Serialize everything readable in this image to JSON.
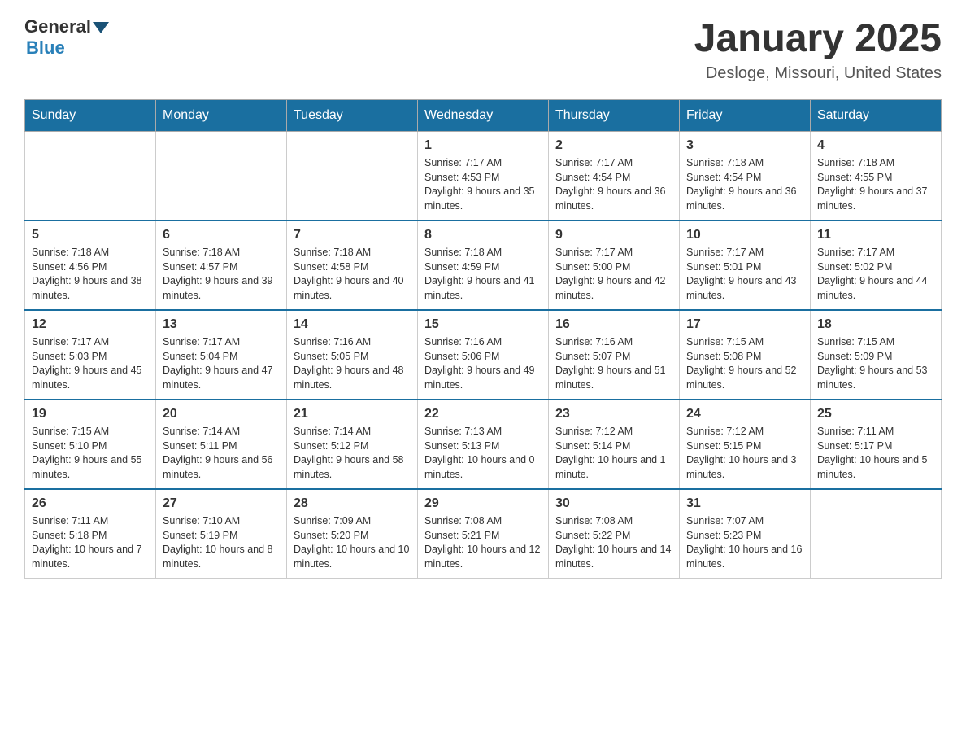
{
  "logo": {
    "general": "General",
    "blue": "Blue"
  },
  "title": {
    "month_year": "January 2025",
    "location": "Desloge, Missouri, United States"
  },
  "weekdays": [
    "Sunday",
    "Monday",
    "Tuesday",
    "Wednesday",
    "Thursday",
    "Friday",
    "Saturday"
  ],
  "weeks": [
    [
      {
        "day": "",
        "info": ""
      },
      {
        "day": "",
        "info": ""
      },
      {
        "day": "",
        "info": ""
      },
      {
        "day": "1",
        "info": "Sunrise: 7:17 AM\nSunset: 4:53 PM\nDaylight: 9 hours and 35 minutes."
      },
      {
        "day": "2",
        "info": "Sunrise: 7:17 AM\nSunset: 4:54 PM\nDaylight: 9 hours and 36 minutes."
      },
      {
        "day": "3",
        "info": "Sunrise: 7:18 AM\nSunset: 4:54 PM\nDaylight: 9 hours and 36 minutes."
      },
      {
        "day": "4",
        "info": "Sunrise: 7:18 AM\nSunset: 4:55 PM\nDaylight: 9 hours and 37 minutes."
      }
    ],
    [
      {
        "day": "5",
        "info": "Sunrise: 7:18 AM\nSunset: 4:56 PM\nDaylight: 9 hours and 38 minutes."
      },
      {
        "day": "6",
        "info": "Sunrise: 7:18 AM\nSunset: 4:57 PM\nDaylight: 9 hours and 39 minutes."
      },
      {
        "day": "7",
        "info": "Sunrise: 7:18 AM\nSunset: 4:58 PM\nDaylight: 9 hours and 40 minutes."
      },
      {
        "day": "8",
        "info": "Sunrise: 7:18 AM\nSunset: 4:59 PM\nDaylight: 9 hours and 41 minutes."
      },
      {
        "day": "9",
        "info": "Sunrise: 7:17 AM\nSunset: 5:00 PM\nDaylight: 9 hours and 42 minutes."
      },
      {
        "day": "10",
        "info": "Sunrise: 7:17 AM\nSunset: 5:01 PM\nDaylight: 9 hours and 43 minutes."
      },
      {
        "day": "11",
        "info": "Sunrise: 7:17 AM\nSunset: 5:02 PM\nDaylight: 9 hours and 44 minutes."
      }
    ],
    [
      {
        "day": "12",
        "info": "Sunrise: 7:17 AM\nSunset: 5:03 PM\nDaylight: 9 hours and 45 minutes."
      },
      {
        "day": "13",
        "info": "Sunrise: 7:17 AM\nSunset: 5:04 PM\nDaylight: 9 hours and 47 minutes."
      },
      {
        "day": "14",
        "info": "Sunrise: 7:16 AM\nSunset: 5:05 PM\nDaylight: 9 hours and 48 minutes."
      },
      {
        "day": "15",
        "info": "Sunrise: 7:16 AM\nSunset: 5:06 PM\nDaylight: 9 hours and 49 minutes."
      },
      {
        "day": "16",
        "info": "Sunrise: 7:16 AM\nSunset: 5:07 PM\nDaylight: 9 hours and 51 minutes."
      },
      {
        "day": "17",
        "info": "Sunrise: 7:15 AM\nSunset: 5:08 PM\nDaylight: 9 hours and 52 minutes."
      },
      {
        "day": "18",
        "info": "Sunrise: 7:15 AM\nSunset: 5:09 PM\nDaylight: 9 hours and 53 minutes."
      }
    ],
    [
      {
        "day": "19",
        "info": "Sunrise: 7:15 AM\nSunset: 5:10 PM\nDaylight: 9 hours and 55 minutes."
      },
      {
        "day": "20",
        "info": "Sunrise: 7:14 AM\nSunset: 5:11 PM\nDaylight: 9 hours and 56 minutes."
      },
      {
        "day": "21",
        "info": "Sunrise: 7:14 AM\nSunset: 5:12 PM\nDaylight: 9 hours and 58 minutes."
      },
      {
        "day": "22",
        "info": "Sunrise: 7:13 AM\nSunset: 5:13 PM\nDaylight: 10 hours and 0 minutes."
      },
      {
        "day": "23",
        "info": "Sunrise: 7:12 AM\nSunset: 5:14 PM\nDaylight: 10 hours and 1 minute."
      },
      {
        "day": "24",
        "info": "Sunrise: 7:12 AM\nSunset: 5:15 PM\nDaylight: 10 hours and 3 minutes."
      },
      {
        "day": "25",
        "info": "Sunrise: 7:11 AM\nSunset: 5:17 PM\nDaylight: 10 hours and 5 minutes."
      }
    ],
    [
      {
        "day": "26",
        "info": "Sunrise: 7:11 AM\nSunset: 5:18 PM\nDaylight: 10 hours and 7 minutes."
      },
      {
        "day": "27",
        "info": "Sunrise: 7:10 AM\nSunset: 5:19 PM\nDaylight: 10 hours and 8 minutes."
      },
      {
        "day": "28",
        "info": "Sunrise: 7:09 AM\nSunset: 5:20 PM\nDaylight: 10 hours and 10 minutes."
      },
      {
        "day": "29",
        "info": "Sunrise: 7:08 AM\nSunset: 5:21 PM\nDaylight: 10 hours and 12 minutes."
      },
      {
        "day": "30",
        "info": "Sunrise: 7:08 AM\nSunset: 5:22 PM\nDaylight: 10 hours and 14 minutes."
      },
      {
        "day": "31",
        "info": "Sunrise: 7:07 AM\nSunset: 5:23 PM\nDaylight: 10 hours and 16 minutes."
      },
      {
        "day": "",
        "info": ""
      }
    ]
  ]
}
